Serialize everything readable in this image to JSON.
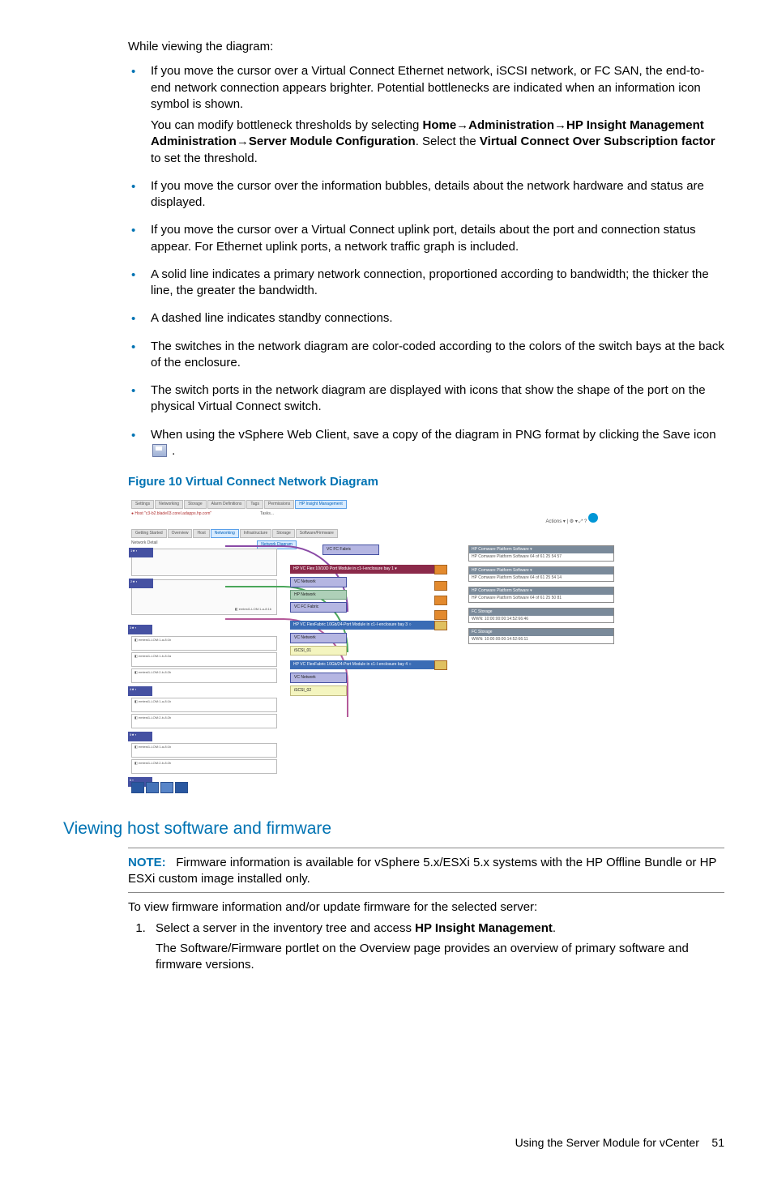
{
  "intro": "While viewing the diagram:",
  "bullets": [
    {
      "text": "If you move the cursor over a Virtual Connect Ethernet network, iSCSI network, or FC SAN, the end-to-end network connection appears brighter. Potential bottlenecks are indicated when an information icon symbol is shown.",
      "sub_pre": "You can modify bottleneck thresholds by selecting ",
      "path1": "Home",
      "path2": "Administration",
      "path3": "HP Insight Management Administration",
      "path4": "Server Module Configuration",
      "sub_mid": ". Select the ",
      "path5": "Virtual Connect Over Subscription factor",
      "sub_post": " to set the threshold."
    },
    {
      "text": "If you move the cursor over the information bubbles, details about the network hardware and status are displayed."
    },
    {
      "text": "If you move the cursor over a Virtual Connect uplink port, details about the port and connection status appear. For Ethernet uplink ports, a network traffic graph is included."
    },
    {
      "text": "A solid line indicates a primary network connection, proportioned according to bandwidth; the thicker the line, the greater the bandwidth."
    },
    {
      "text": "A dashed line indicates standby connections."
    },
    {
      "text": "The switches in the network diagram are color-coded according to the colors of the switch bays at the back of the enclosure."
    },
    {
      "text": "The switch ports in the network diagram are displayed with icons that show the shape of the port on the physical Virtual Connect switch."
    },
    {
      "text_pre": "When using the vSphere Web Client, save a copy of the diagram in PNG format by clicking the Save icon ",
      "text_post": "."
    }
  ],
  "figure_title": "Figure 10 Virtual Connect Network Diagram",
  "figure": {
    "tabs": [
      "Settings",
      "Networking",
      "Storage",
      "Alarm Definitions",
      "Tags",
      "Permissions",
      "HP Insight Management"
    ],
    "host_label": "Host \"c3-b2.blade03.corel.adapps.hp.com\"",
    "tasks": "Tasks...",
    "actions": "Actions",
    "subtabs": [
      "Getting Started",
      "Overview",
      "Host",
      "Networking",
      "Infrastructure",
      "Storage",
      "Software/Firmware"
    ],
    "nd_label": "Network Detail",
    "nd_tab": "Network Diagram",
    "mid_hdr1": "HP VC Flex 10/10D Port Module in c1-I-enclosure bay 1",
    "vc_fabric": "VC FC Fabric",
    "vc_network": "VC Network",
    "hp_net": "HP Network",
    "mid_hdr2": "HP VC FlexFabric 10Gb/24-Port Module in c1-I-enclosure bay 3",
    "iscsi": "iSCSI_01",
    "mid_hdr3": "HP VC FlexFabric 10Gb/24-Port Module in c1-I-enclosure bay 4",
    "iscsi2": "iSCSI_02",
    "r1_hd": "HP Comware Platform Software",
    "r1_bd": "HP Comware Platform Software\n64 of 61 25 54 57",
    "r2_bd": "HP Comware Platform Software\n64 of 61 25 54 14",
    "r3_bd": "HP Comware Platform Software\n64 of 61 25 50 81",
    "r4_hd": "FC Storage",
    "r4_bd": "WWN: 10:00:00:00:14:52:66:46",
    "r5_bd": "WWN: 10:00:00:00:14:52:66:11",
    "nic": "emtest1-LOM:1-a-8:1b",
    "nic2": "emtest1-LOM:1-b-8:2a",
    "nic3": "emtest1-LOM:2-b-8:2b"
  },
  "section_title": "Viewing host software and firmware",
  "note_label": "NOTE:",
  "note_text": "Firmware information is available for vSphere 5.x/ESXi 5.x systems with the HP Offline Bundle or HP ESXi custom image installed only.",
  "fw_intro": "To view firmware information and/or update firmware for the selected server:",
  "step1_pre": "Select a server in the inventory tree and access ",
  "step1_bold": "HP Insight Management",
  "step1_post": ".",
  "step1_cont": "The Software/Firmware portlet on the Overview page provides an overview of primary software and firmware versions.",
  "footer": "Using the Server Module for vCenter",
  "page": "51"
}
